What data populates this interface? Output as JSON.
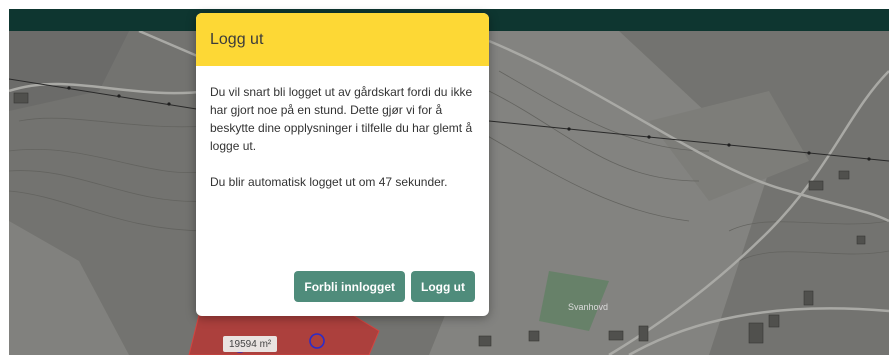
{
  "dialog": {
    "title": "Logg ut",
    "message": "Du vil snart bli logget ut av gårdskart fordi du ikke har gjort noe på en stund. Dette gjør vi for å beskytte dine opplysninger i tilfelle du har glemt å logge ut.",
    "countdown": "Du blir automatisk logget ut om 47 sekunder.",
    "stay_label": "Forbli innlogget",
    "logout_label": "Logg ut"
  },
  "map": {
    "place_label": "Svanhovd",
    "area_label": "19594 m²"
  },
  "colors": {
    "header_bar": "#0f3a33",
    "dialog_header": "#fdd835",
    "button": "#4f8c7b",
    "selection": "#d23a3a"
  }
}
